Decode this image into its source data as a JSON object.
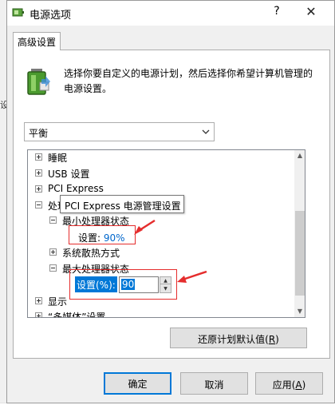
{
  "background": {
    "left_fragment": "设"
  },
  "window": {
    "title": "电源选项",
    "help_glyph": "?",
    "close_glyph": "✕"
  },
  "tab": {
    "label": "高级设置"
  },
  "intro": {
    "text": "选择你要自定义的电源计划，然后选择你希望计算机管理的电源设置。"
  },
  "plan": {
    "selected": "平衡"
  },
  "tree": {
    "items": [
      {
        "label": "睡眠"
      },
      {
        "label": "USB 设置"
      },
      {
        "label": "PCI Express"
      },
      {
        "label": "处理"
      },
      {
        "label": "最小处理器状态"
      },
      {
        "label": "系统散热方式"
      },
      {
        "label": "最大处理器状态"
      },
      {
        "label": "显示"
      },
      {
        "label": "“多媒体”设置"
      }
    ],
    "min_setting_label": "设置:",
    "min_setting_value": "90%",
    "max_setting_label": "设置(%):",
    "max_setting_value": "90"
  },
  "tooltip": {
    "text": "PCI Express 电源管理设置"
  },
  "buttons": {
    "restore_prefix": "还原计划默认值(",
    "restore_key": "R",
    "restore_suffix": ")",
    "ok": "确定",
    "cancel": "取消",
    "apply_prefix": "应用(",
    "apply_key": "A",
    "apply_suffix": ")"
  },
  "colors": {
    "annotation": "#e52d2d",
    "selection": "#0078d7",
    "value_text": "#0066cc"
  }
}
